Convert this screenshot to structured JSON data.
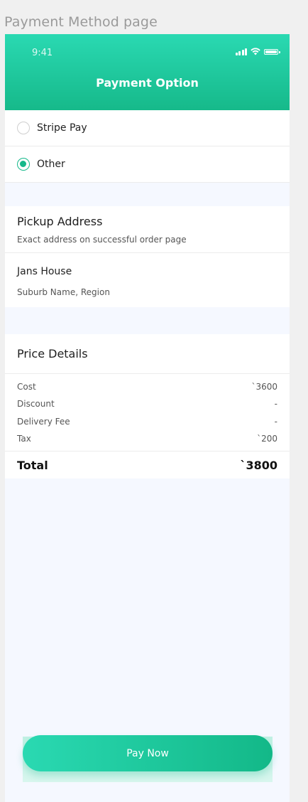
{
  "frame_label": "Payment Method page",
  "status_bar": {
    "time": "9:41"
  },
  "header": {
    "title": "Payment Option"
  },
  "payment_options": [
    {
      "label": "Stripe Pay",
      "selected": false
    },
    {
      "label": "Other",
      "selected": true
    }
  ],
  "pickup": {
    "title": "Pickup Address",
    "subtitle": "Exact address on successful order page",
    "name": "Jans House",
    "location": "Suburb Name, Region"
  },
  "price_details": {
    "title": "Price Details",
    "rows": [
      {
        "label": "Cost",
        "value": "`3600"
      },
      {
        "label": "Discount",
        "value": "-"
      },
      {
        "label": "Delivery Fee",
        "value": "-"
      },
      {
        "label": "Tax",
        "value": "`200"
      }
    ],
    "total_label": "Total",
    "total_value": "`3800"
  },
  "pay_button": {
    "label": "Pay Now"
  },
  "colors": {
    "accent": "#14b88a",
    "accent_light": "#2ad9b2",
    "background": "#f5f8ff"
  },
  "icons": {
    "signal": "cellular-signal-icon",
    "wifi": "wifi-icon",
    "battery": "battery-icon"
  }
}
